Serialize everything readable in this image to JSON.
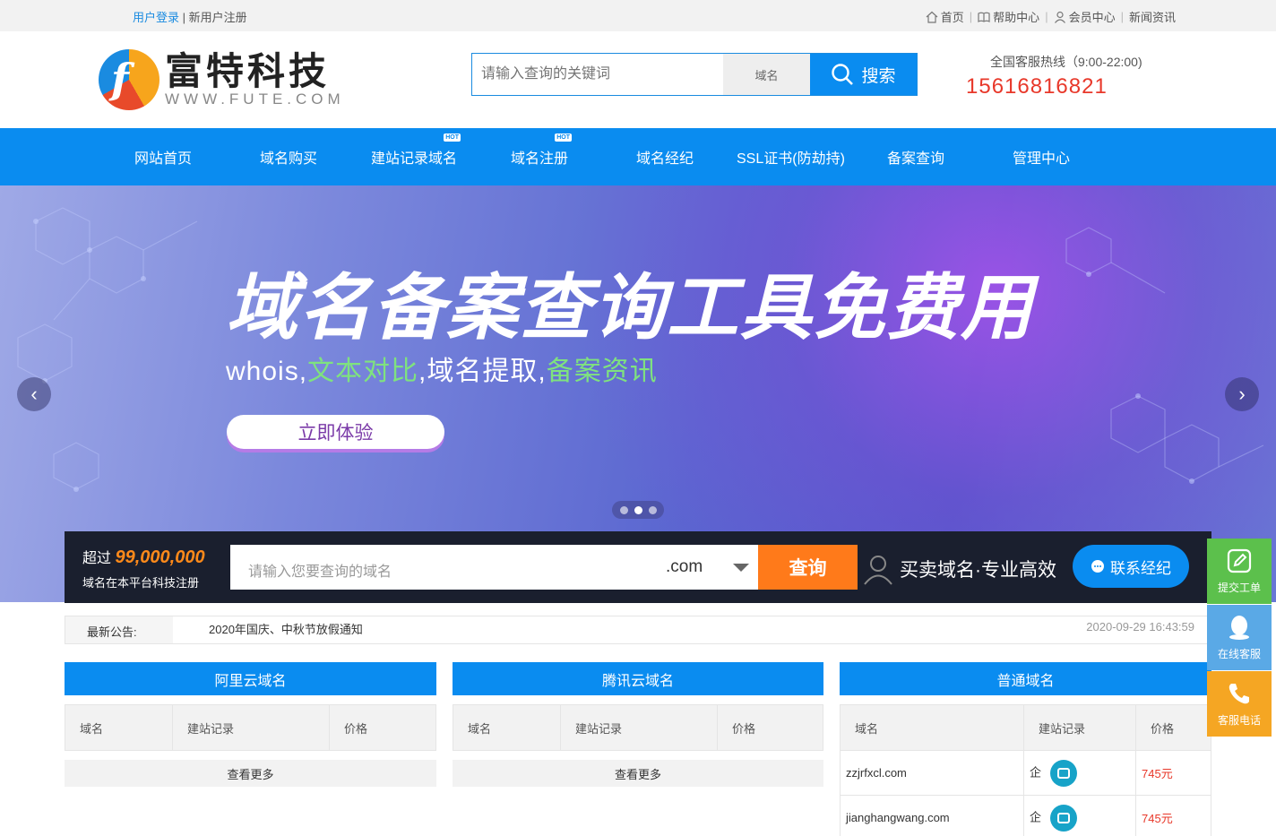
{
  "topbar": {
    "login": "用户登录",
    "divider": "|",
    "register": "新用户注册",
    "links": [
      "首页",
      "帮助中心",
      "会员中心",
      "新闻资讯"
    ]
  },
  "header": {
    "logo_mark": "f",
    "logo_name": "富特科技",
    "logo_url": "WWW.FUTE.COM",
    "search_placeholder": "请输入查询的关键词",
    "search_type": "域名",
    "search_button": "搜索",
    "hotline_label": "全国客服热线（9:00-22:00)",
    "hotline_number": "15616816821"
  },
  "nav": {
    "items": [
      "网站首页",
      "域名购买",
      "建站记录域名",
      "域名注册",
      "域名经纪",
      "SSL证书(防劫持)",
      "备案查询",
      "管理中心"
    ],
    "hot_badge": "HOT"
  },
  "banner": {
    "title": "域名备案查询工具免费用",
    "sub_1": "whois,",
    "sub_2": "文本对比",
    "sub_3": ",域名提取,",
    "sub_4": "备案资讯",
    "cta": "立即体验",
    "prev": "‹",
    "next": "›",
    "slide_count": 3,
    "active_slide": 2
  },
  "domain_search": {
    "stat_prefix": "超过",
    "stat_number": "99,000,000",
    "stat_desc": "域名在本平台科技注册",
    "placeholder": "请输入您要查询的域名",
    "tld": ".com",
    "query_button": "查询",
    "slogan": "买卖域名·专业高效",
    "contact_button": "联系经纪"
  },
  "notice": {
    "label": "最新公告:",
    "message": "2020年国庆、中秋节放假通知",
    "date": "2020-09-29 16:43:59"
  },
  "panels": [
    {
      "title": "阿里云域名",
      "headers": [
        "域名",
        "建站记录",
        "价格"
      ],
      "rows": [],
      "more": "查看更多"
    },
    {
      "title": "腾讯云域名",
      "headers": [
        "域名",
        "建站记录",
        "价格"
      ],
      "rows": [],
      "more": "查看更多"
    },
    {
      "title": "普通域名",
      "headers": [
        "域名",
        "建站记录",
        "价格"
      ],
      "rows": [
        {
          "domain": "zzjrfxcl.com",
          "record": "企",
          "price": "745元"
        },
        {
          "domain": "jianghangwang.com",
          "record": "企",
          "price": "745元"
        }
      ]
    }
  ],
  "side_tools": [
    {
      "label": "提交工单",
      "color": "#5cc04c",
      "icon": "edit-icon"
    },
    {
      "label": "在线客服",
      "color": "#5aa9e6",
      "icon": "qq-icon"
    },
    {
      "label": "客服电话",
      "color": "#f5a623",
      "icon": "phone-icon"
    }
  ]
}
